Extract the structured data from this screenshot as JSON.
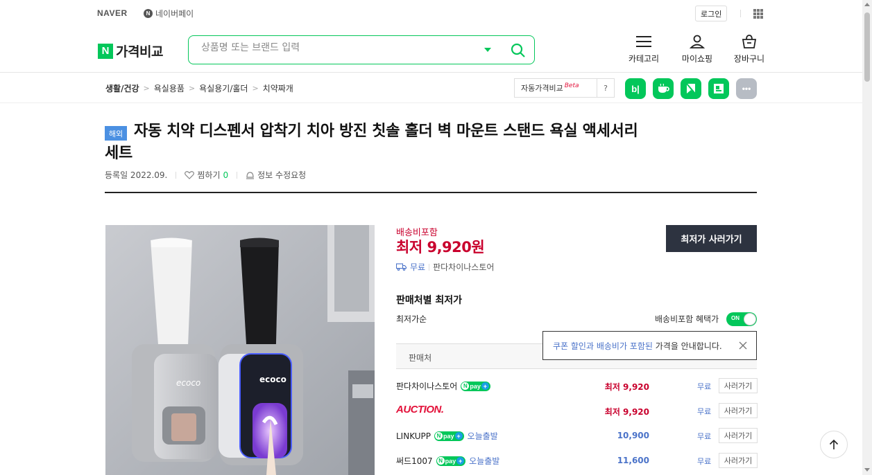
{
  "top": {
    "naver": "NAVER",
    "npay_mark": "N",
    "npay": "네이버페이",
    "login": "로그인"
  },
  "header": {
    "brand_mark": "N",
    "brand": "가격비교",
    "search_placeholder": "상품명 또는 브랜드 입력",
    "category": "카테고리",
    "myshopping": "마이쇼핑",
    "cart": "장바구니"
  },
  "breadcrumb": [
    "생활/건강",
    "욕실용품",
    "욕실용기/홀더",
    "치약짜개"
  ],
  "breadcrumb_sep": ">",
  "compare": {
    "label": "자동가격비교",
    "beta": "Beta",
    "help": "?"
  },
  "share": {
    "blog": "b|",
    "more": "•••"
  },
  "product": {
    "badge": "해외",
    "title": "자동 치약 디스펜서 압착기 치아 방진 칫솔 홀더 벽 마운트 스탠드 욕실 액세서리 세트",
    "registered": "등록일 2022.09.",
    "wish_label": "찜하기",
    "wish_count": "0",
    "edit_request": "정보 수정요청",
    "image_brand_left": "ecoco",
    "image_brand_right": "ecoco"
  },
  "price": {
    "shipping_included": "배송비포함",
    "lowest": "최저 9,920원",
    "buy_button": "최저가 사러가기",
    "ship_free": "무료",
    "store": "판다차이나스토어"
  },
  "offers": {
    "section_title": "판매처별 최저가",
    "sort": "최저가순",
    "toggle_label": "배송비포함 혜택가",
    "toggle_state": "ON",
    "header_seller": "판매처",
    "tooltip_blue": "쿠폰 할인과 배송비가 포함된",
    "tooltip_rest": " 가격을 안내합니다.",
    "npay_n": "N",
    "npay_word": "pay",
    "npay_plus": "+",
    "rows": [
      {
        "seller": "판다차이나스토어",
        "npay": true,
        "today": "",
        "price": "최저 9,920",
        "ship": "무료",
        "go": "사러가기",
        "color": "#c9002d"
      },
      {
        "seller": "AUCTION.",
        "npay": false,
        "today": "",
        "price": "최저 9,920",
        "ship": "무료",
        "go": "사러가기",
        "color": "#c9002d"
      },
      {
        "seller": "LINKUPP",
        "npay": true,
        "today": "오늘출발",
        "price": "10,900",
        "ship": "무료",
        "go": "사러가기",
        "color": "#4b73c9"
      },
      {
        "seller": "써드1007",
        "npay": true,
        "today": "오늘출발",
        "price": "11,600",
        "ship": "무료",
        "go": "사러가기",
        "color": "#4b73c9"
      }
    ]
  },
  "colors": {
    "naver_green": "#03c75a",
    "price_red": "#c9002d",
    "link_blue": "#4b73c9",
    "dark_button": "#2d3340"
  }
}
